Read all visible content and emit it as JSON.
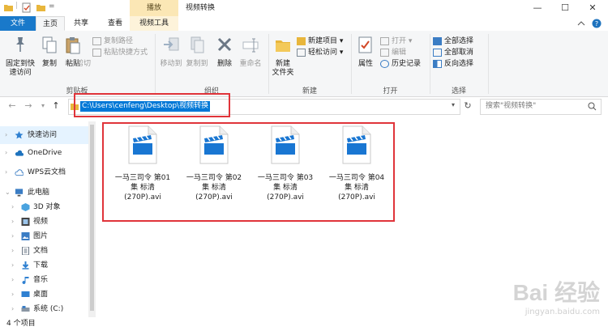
{
  "window": {
    "title": "视频转换",
    "contextual_tab": "播放",
    "minimize_glyph": "—",
    "maximize_glyph": "☐",
    "close_glyph": "✕",
    "quick_access_dropdown": "="
  },
  "tabs": [
    "文件",
    "主页",
    "共享",
    "查看",
    "视频工具"
  ],
  "ribbon": {
    "clipboard": {
      "pin_label_1": "固定到快",
      "pin_label_2": "速访问",
      "copy_label": "复制",
      "paste_label": "粘贴",
      "copy_path": "复制路径",
      "paste_shortcut": "粘贴快捷方式",
      "cut": "剪切",
      "group_label": "剪贴板"
    },
    "organize": {
      "move_to": "移动到",
      "copy_to": "复制到",
      "delete": "删除",
      "rename": "重命名",
      "group_label": "组织"
    },
    "new": {
      "new_folder_1": "新建",
      "new_folder_2": "文件夹",
      "new_item": "新建项目",
      "easy_access": "轻松访问",
      "group_label": "新建"
    },
    "open": {
      "properties": "属性",
      "open": "打开",
      "edit": "编辑",
      "history": "历史记录",
      "group_label": "打开"
    },
    "select": {
      "select_all": "全部选择",
      "select_none": "全部取消",
      "invert": "反向选择",
      "group_label": "选择"
    }
  },
  "address": {
    "path": "C:\\Users\\cenfeng\\Desktop\\视频转换",
    "search_placeholder": "搜索\"视频转换\""
  },
  "nav_pane": [
    {
      "label": "快速访问",
      "icon": "star-icon"
    },
    {
      "label": "OneDrive",
      "icon": "cloud-icon"
    },
    {
      "label": "WPS云文档",
      "icon": "wps-cloud-icon"
    },
    {
      "label": "此电脑",
      "icon": "computer-icon"
    },
    {
      "label": "3D 对象",
      "icon": "cube-icon"
    },
    {
      "label": "视频",
      "icon": "video-folder-icon"
    },
    {
      "label": "图片",
      "icon": "pictures-folder-icon"
    },
    {
      "label": "文档",
      "icon": "documents-folder-icon"
    },
    {
      "label": "下载",
      "icon": "download-icon"
    },
    {
      "label": "音乐",
      "icon": "music-icon"
    },
    {
      "label": "桌面",
      "icon": "desktop-icon"
    },
    {
      "label": "系统 (C:)",
      "icon": "drive-icon"
    }
  ],
  "files": [
    {
      "line1": "一马三司令 第01",
      "line2": "集 标清",
      "line3": "(270P).avi"
    },
    {
      "line1": "一马三司令 第02",
      "line2": "集 标清",
      "line3": "(270P).avi"
    },
    {
      "line1": "一马三司令 第03",
      "line2": "集 标清",
      "line3": "(270P).avi"
    },
    {
      "line1": "一马三司令 第04",
      "line2": "集 标清",
      "line3": "(270P).avi"
    }
  ],
  "status": {
    "count": "4 个项目"
  },
  "watermark": {
    "brand": "Bai 经验",
    "site": "jingyan.baidu.com"
  },
  "colors": {
    "accent": "#0078d7",
    "file_tab": "#1979ca",
    "highlight_box": "#e0343a",
    "video_icon": "#1976d2"
  }
}
